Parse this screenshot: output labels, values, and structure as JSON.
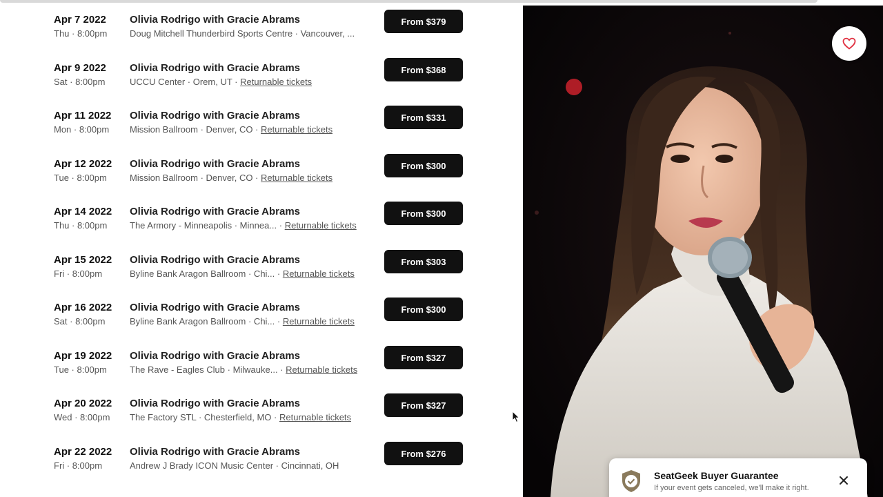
{
  "events": [
    {
      "date": "Apr 7 2022",
      "time": "Thu · 8:00pm",
      "title": "Olivia Rodrigo with Gracie Abrams",
      "venue": "Doug Mitchell Thunderbird Sports Centre · Vancouver, ...",
      "returnable": "",
      "price": "From $379"
    },
    {
      "date": "Apr 9 2022",
      "time": "Sat · 8:00pm",
      "title": "Olivia Rodrigo with Gracie Abrams",
      "venue": "UCCU Center · Orem, UT ·",
      "returnable": "Returnable tickets",
      "price": "From $368"
    },
    {
      "date": "Apr 11 2022",
      "time": "Mon · 8:00pm",
      "title": "Olivia Rodrigo with Gracie Abrams",
      "venue": "Mission Ballroom · Denver, CO ·",
      "returnable": "Returnable tickets",
      "price": "From $331"
    },
    {
      "date": "Apr 12 2022",
      "time": "Tue · 8:00pm",
      "title": "Olivia Rodrigo with Gracie Abrams",
      "venue": "Mission Ballroom · Denver, CO ·",
      "returnable": "Returnable tickets",
      "price": "From $300"
    },
    {
      "date": "Apr 14 2022",
      "time": "Thu · 8:00pm",
      "title": "Olivia Rodrigo with Gracie Abrams",
      "venue": "The Armory - Minneapolis · Minnea... ·",
      "returnable": "Returnable tickets",
      "price": "From $300"
    },
    {
      "date": "Apr 15 2022",
      "time": "Fri · 8:00pm",
      "title": "Olivia Rodrigo with Gracie Abrams",
      "venue": "Byline Bank Aragon Ballroom · Chi... ·",
      "returnable": "Returnable tickets",
      "price": "From $303"
    },
    {
      "date": "Apr 16 2022",
      "time": "Sat · 8:00pm",
      "title": "Olivia Rodrigo with Gracie Abrams",
      "venue": "Byline Bank Aragon Ballroom · Chi... ·",
      "returnable": "Returnable tickets",
      "price": "From $300"
    },
    {
      "date": "Apr 19 2022",
      "time": "Tue · 8:00pm",
      "title": "Olivia Rodrigo with Gracie Abrams",
      "venue": "The Rave - Eagles Club · Milwauke... ·",
      "returnable": "Returnable tickets",
      "price": "From $327"
    },
    {
      "date": "Apr 20 2022",
      "time": "Wed · 8:00pm",
      "title": "Olivia Rodrigo with Gracie Abrams",
      "venue": "The Factory STL · Chesterfield, MO ·",
      "returnable": "Returnable tickets",
      "price": "From $327"
    },
    {
      "date": "Apr 22 2022",
      "time": "Fri · 8:00pm",
      "title": "Olivia Rodrigo with Gracie Abrams",
      "venue": "Andrew J Brady ICON Music Center · Cincinnati, OH",
      "returnable": "",
      "price": "From $276"
    }
  ],
  "photo": {
    "favorite_icon": "heart-icon",
    "accent": "#e03040"
  },
  "guarantee": {
    "title": "SeatGeek Buyer Guarantee",
    "subtitle": "If your event gets canceled, we'll make it right.",
    "icon": "shield-check-icon",
    "close_icon": "close-icon"
  }
}
